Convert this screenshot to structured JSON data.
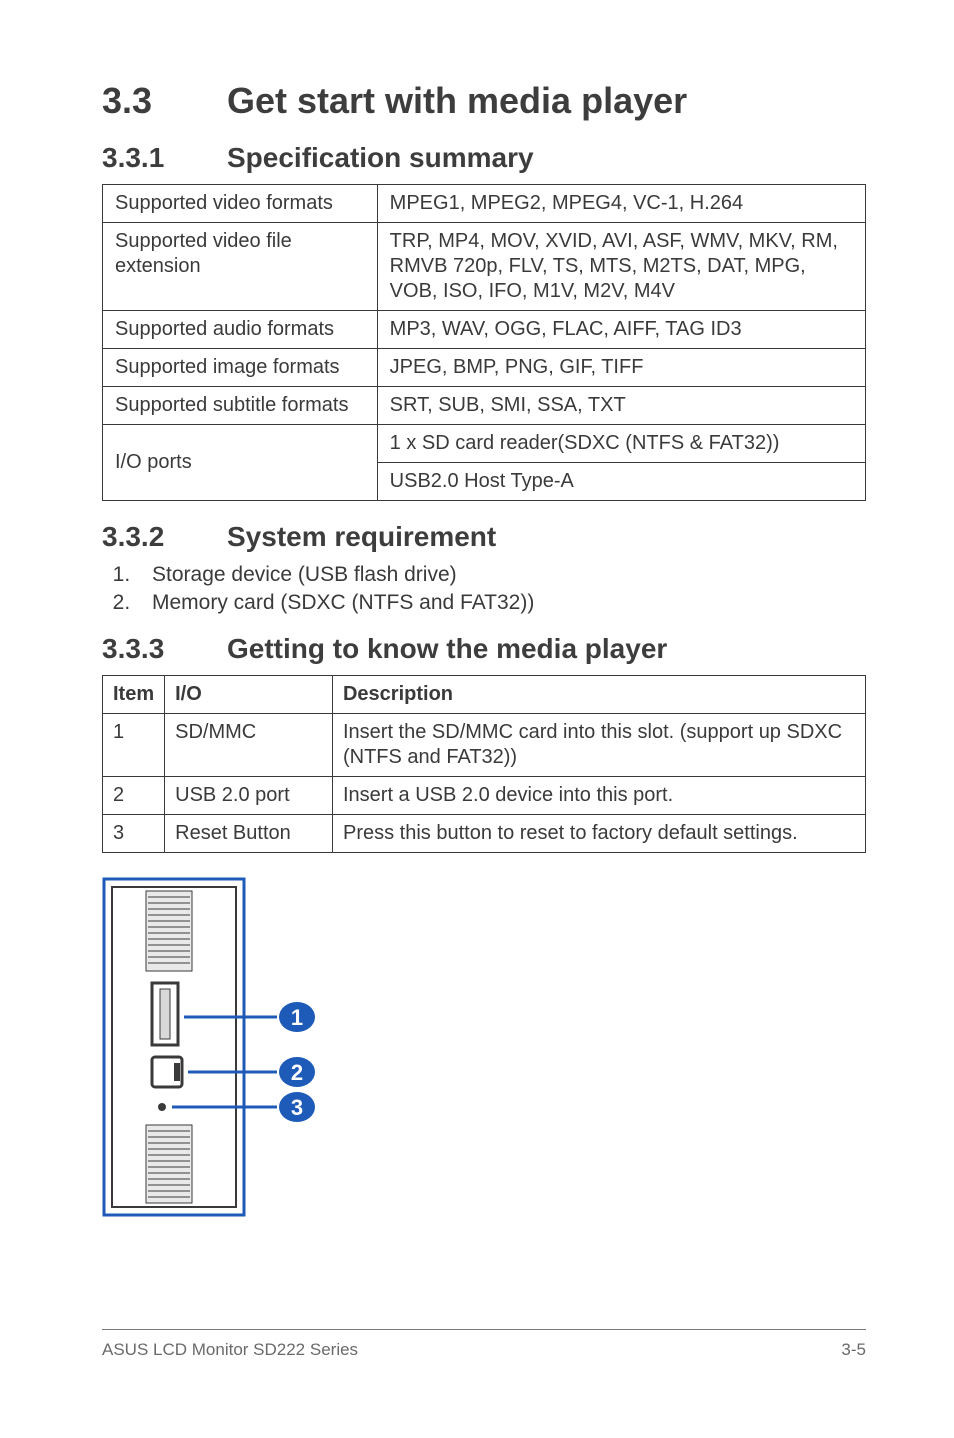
{
  "section": {
    "number": "3.3",
    "title": "Get start with media player"
  },
  "sub1": {
    "number": "3.3.1",
    "title": "Specification summary"
  },
  "spec_table": {
    "rows": [
      {
        "label": "Supported video formats",
        "value": "MPEG1, MPEG2, MPEG4, VC-1, H.264"
      },
      {
        "label": "Supported video file extension",
        "value": "TRP, MP4, MOV, XVID, AVI, ASF, WMV, MKV, RM, RMVB 720p, FLV, TS, MTS, M2TS, DAT, MPG, VOB, ISO, IFO, M1V, M2V, M4V"
      },
      {
        "label": "Supported audio formats",
        "value": "MP3, WAV, OGG, FLAC, AIFF, TAG ID3"
      },
      {
        "label": "Supported image formats",
        "value": "JPEG, BMP, PNG, GIF, TIFF"
      },
      {
        "label": "Supported subtitle formats",
        "value": "SRT, SUB, SMI, SSA, TXT"
      }
    ],
    "io_label": "I/O ports",
    "io_values": [
      "1 x SD card reader(SDXC (NTFS & FAT32))",
      "USB2.0 Host Type-A"
    ]
  },
  "sub2": {
    "number": "3.3.2",
    "title": "System requirement"
  },
  "requirements": [
    "Storage device (USB flash drive)",
    "Memory card (SDXC (NTFS and FAT32))"
  ],
  "sub3": {
    "number": "3.3.3",
    "title": "Getting to know the media player"
  },
  "io_table": {
    "headers": {
      "item": "Item",
      "io": "I/O",
      "desc": "Description"
    },
    "rows": [
      {
        "item": "1",
        "io": "SD/MMC",
        "desc": "Insert the SD/MMC card into this slot. (support up SDXC (NTFS and FAT32))"
      },
      {
        "item": "2",
        "io": "USB 2.0 port",
        "desc": "Insert a USB 2.0 device into this port."
      },
      {
        "item": "3",
        "io": "Reset Button",
        "desc": "Press this button to reset to factory default settings."
      }
    ]
  },
  "callouts": {
    "c1": "1",
    "c2": "2",
    "c3": "3"
  },
  "footer": {
    "left": "ASUS LCD Monitor SD222 Series",
    "right": "3-5"
  }
}
